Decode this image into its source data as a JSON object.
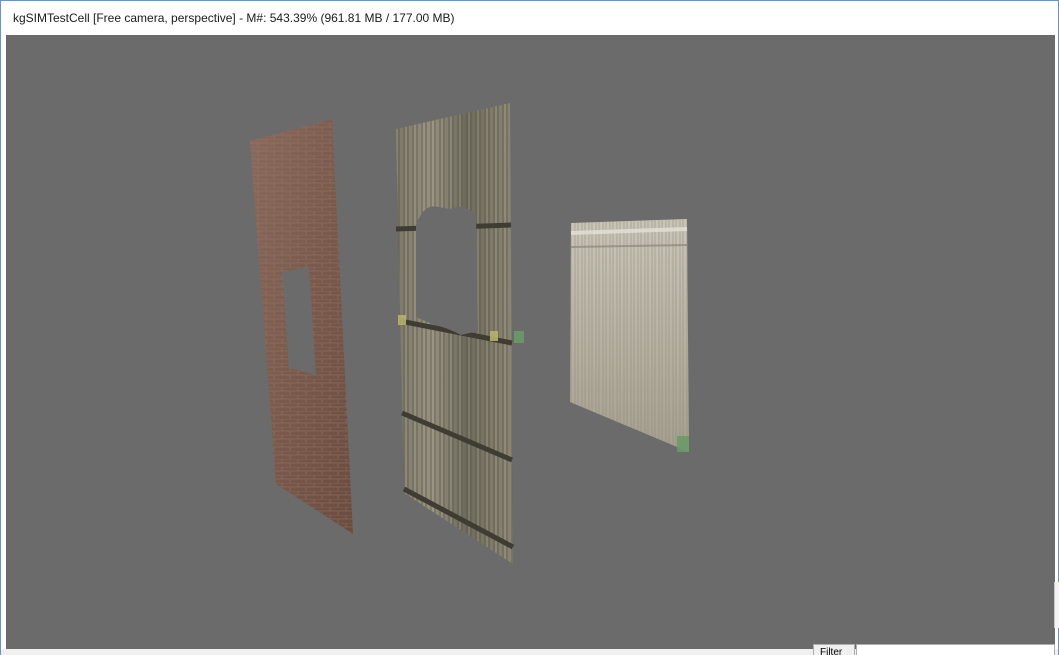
{
  "window": {
    "title": "kgSIMTestCell [Free camera, perspective] - M#: 543.39% (961.81 MB / 177.00 MB)"
  },
  "viewport": {
    "background_color": "#6b6b6b",
    "objects": [
      "brick-wall-panel",
      "wooden-wall-panel-with-window",
      "plank-wall-panel"
    ]
  },
  "bottom_panel": {
    "filter_label": "Filter"
  },
  "colors": {
    "window_border": "#6b8fd0",
    "titlebar_bg": "#ffffff"
  }
}
